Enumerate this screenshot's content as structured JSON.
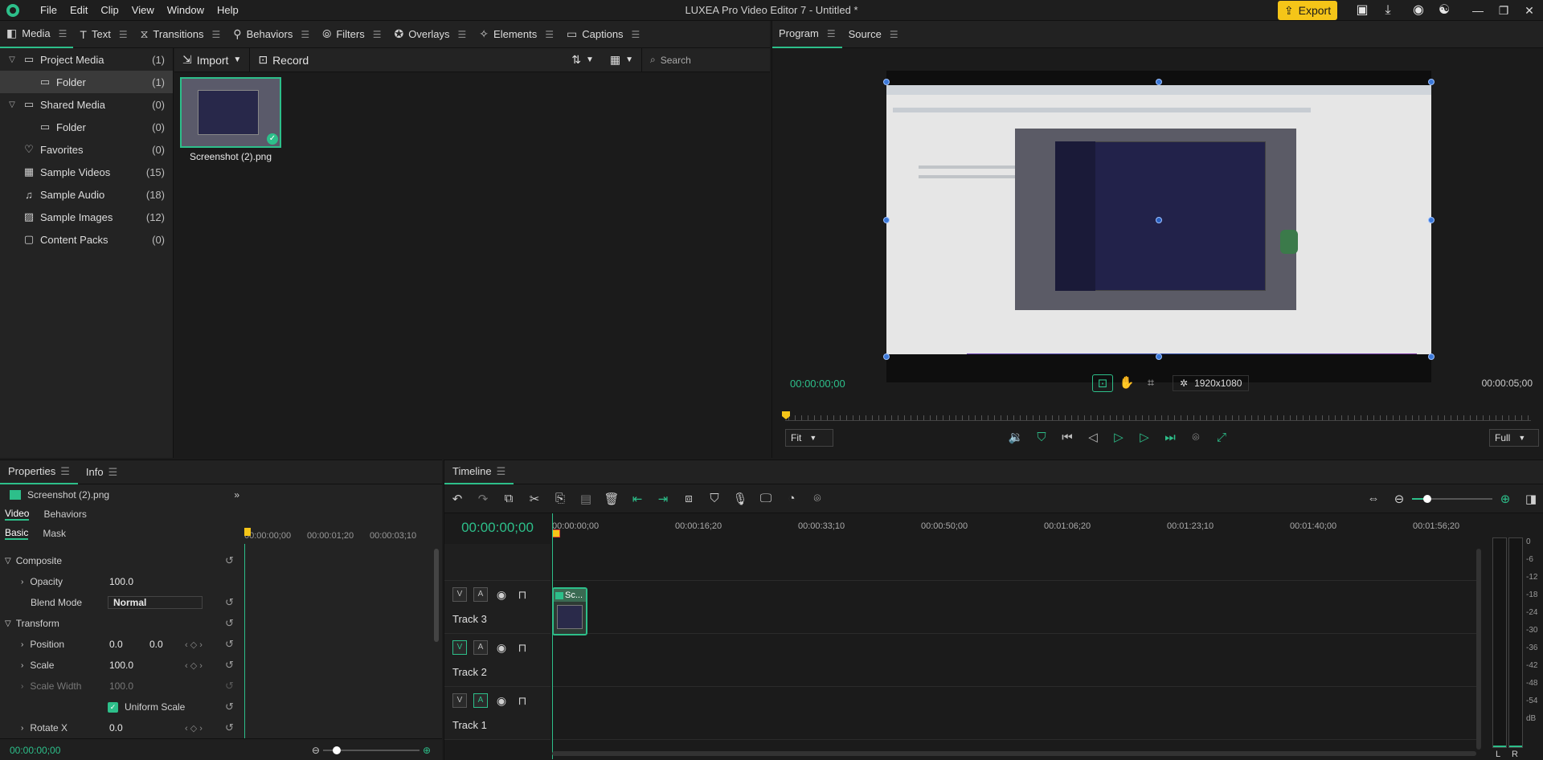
{
  "app": {
    "title": "LUXEA Pro Video Editor 7 - Untitled *",
    "menu": [
      "File",
      "Edit",
      "Clip",
      "View",
      "Window",
      "Help"
    ],
    "export_label": "Export",
    "accent": "#2dbf8a",
    "export_color": "#f5c518"
  },
  "library": {
    "tabs": [
      {
        "label": "Media",
        "icon": "media-icon"
      },
      {
        "label": "Text",
        "icon": "text-icon"
      },
      {
        "label": "Transitions",
        "icon": "transitions-icon"
      },
      {
        "label": "Behaviors",
        "icon": "behaviors-icon"
      },
      {
        "label": "Filters",
        "icon": "filters-icon"
      },
      {
        "label": "Overlays",
        "icon": "overlays-icon"
      },
      {
        "label": "Elements",
        "icon": "elements-icon"
      },
      {
        "label": "Captions",
        "icon": "captions-icon"
      }
    ],
    "tree": [
      {
        "label": "Project Media",
        "count": "(1)"
      },
      {
        "label": "Folder",
        "count": "(1)"
      },
      {
        "label": "Shared Media",
        "count": "(0)"
      },
      {
        "label": "Folder",
        "count": "(0)"
      },
      {
        "label": "Favorites",
        "count": "(0)"
      },
      {
        "label": "Sample Videos",
        "count": "(15)"
      },
      {
        "label": "Sample Audio",
        "count": "(18)"
      },
      {
        "label": "Sample Images",
        "count": "(12)"
      },
      {
        "label": "Content Packs",
        "count": "(0)"
      }
    ],
    "import_label": "Import",
    "record_label": "Record",
    "search_placeholder": "Search",
    "media_items": [
      {
        "name": "Screenshot (2).png"
      }
    ]
  },
  "viewer": {
    "tabs": [
      "Program",
      "Source"
    ],
    "current_time": "00:00:00;00",
    "end_time": "00:00:05;00",
    "resolution": "1920x1080",
    "zoom": "Fit",
    "quality": "Full"
  },
  "properties": {
    "tabs": [
      "Properties",
      "Info"
    ],
    "clip_name": "Screenshot (2).png",
    "subtabs": [
      "Video",
      "Behaviors"
    ],
    "subsubtabs": [
      "Basic",
      "Mask"
    ],
    "mini_ruler": [
      "00:00:00;00",
      "00:00:01;20",
      "00:00:03;10"
    ],
    "sections": {
      "composite": "Composite",
      "transform": "Transform"
    },
    "rows": {
      "opacity": {
        "label": "Opacity",
        "value": "100.0"
      },
      "blend": {
        "label": "Blend Mode",
        "value": "Normal"
      },
      "position": {
        "label": "Position",
        "x": "0.0",
        "y": "0.0"
      },
      "scale": {
        "label": "Scale",
        "value": "100.0"
      },
      "scale_width": {
        "label": "Scale Width",
        "value": "100.0"
      },
      "uniform": {
        "label": "Uniform Scale"
      },
      "rotate_x": {
        "label": "Rotate X",
        "value": "0.0"
      }
    },
    "footer_time": "00:00:00;00"
  },
  "timeline": {
    "tab": "Timeline",
    "timecode": "00:00:00;00",
    "ruler": [
      "00:00:00;00",
      "00:00:16;20",
      "00:00:33;10",
      "00:00:50;00",
      "00:01:06;20",
      "00:01:23;10",
      "00:01:40;00",
      "00:01:56;20"
    ],
    "tracks": [
      "Track 3",
      "Track 2",
      "Track 1"
    ],
    "clip_label": "Sc...",
    "meter_scale": [
      "0",
      "-6",
      "-12",
      "-18",
      "-24",
      "-30",
      "-36",
      "-42",
      "-48",
      "-54",
      "dB"
    ],
    "meter_channels": [
      "L",
      "R"
    ]
  }
}
